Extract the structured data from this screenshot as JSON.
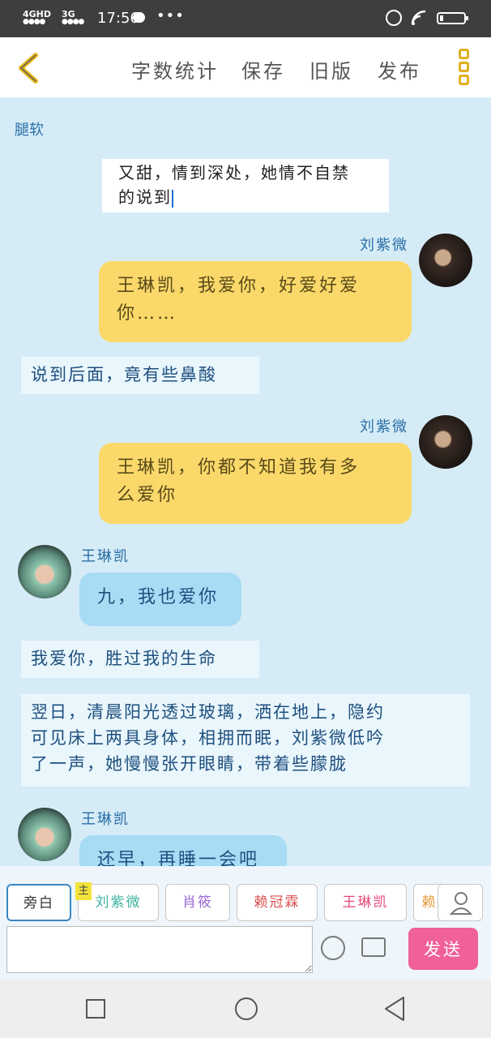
{
  "status_bar": {
    "network_1": "4GHD",
    "network_2": "3G",
    "time": "17:56",
    "more": "•••",
    "battery_level": 0.15
  },
  "toolbar": {
    "word_count": "字数统计",
    "save": "保存",
    "old_version": "旧版",
    "publish": "发布"
  },
  "chat": {
    "chapter_title": "腿软",
    "editing_text_line1": "又甜，情到深处，她情不自禁",
    "editing_text_line2": "的说到",
    "messages": [
      {
        "type": "right",
        "speaker": "刘紫微",
        "text_line1": "王琳凯，我爱你，好爱好爱",
        "text_line2": "你……"
      },
      {
        "type": "narration",
        "text": "说到后面，竟有些鼻酸"
      },
      {
        "type": "right",
        "speaker": "刘紫微",
        "text_line1": "王琳凯，你都不知道我有多",
        "text_line2": "么爱你"
      },
      {
        "type": "left",
        "speaker": "王琳凯",
        "text": "九，我也爱你"
      },
      {
        "type": "narration",
        "text": "我爱你，胜过我的生命"
      },
      {
        "type": "narration",
        "text_line1": "翌日，清晨阳光透过玻璃，洒在地上，隐约",
        "text_line2": "可见床上两具身体，相拥而眠，刘紫微低吟",
        "text_line3": "了一声，她慢慢张开眼睛，带着些朦胧"
      },
      {
        "type": "left",
        "speaker": "王琳凯",
        "text": "还早，再睡一会吧"
      }
    ]
  },
  "character_bar": {
    "chips": [
      "旁白",
      "刘紫微",
      "肖筱",
      "赖冠霖",
      "王琳凯",
      "赖"
    ],
    "main_tag": "主"
  },
  "input": {
    "placeholder": "",
    "send_label": "发送"
  },
  "colors": {
    "send": "#f0609a",
    "right_bubble": "#fad96a",
    "left_bubble": "#a8dcf5",
    "background": "#d5ecf7"
  }
}
